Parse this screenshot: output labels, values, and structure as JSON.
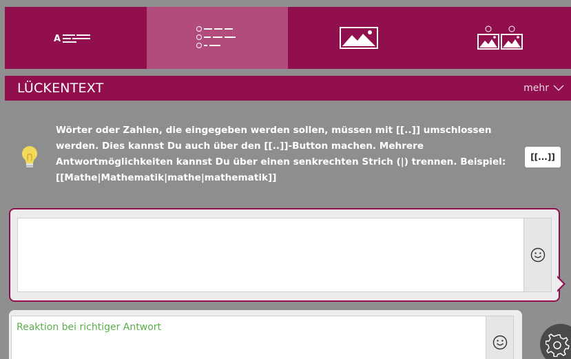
{
  "tabs": [
    {
      "icon": "text-icon",
      "label": "Text"
    },
    {
      "icon": "list-choice-icon",
      "label": "Liste"
    },
    {
      "icon": "image-icon",
      "label": "Bild"
    },
    {
      "icon": "image-compare-icon",
      "label": "Bildvergleich"
    }
  ],
  "header": {
    "title": "LÜCKENTEXT",
    "more_label": "mehr"
  },
  "hint": {
    "text": "Wörter oder Zahlen, die eingegeben werden sollen, müssen mit [[..]] umschlossen werden. Dies kannst Du auch über den [[..]]-Button machen. Mehrere Antwortmöglichkeiten kannst Du über einen senkrechten Strich (|) trennen. Beispiel: [[Mathe|Mathematik|mathe|mathematik]]",
    "insert_button": "[[...]]"
  },
  "editor": {
    "value": ""
  },
  "feedback": {
    "placeholder": "Reaktion bei richtiger Antwort"
  },
  "colors": {
    "brand": "#920f4d",
    "tab_active": "#b14c7c",
    "background": "#8f8f8f",
    "feedback_text": "#5aaf49"
  }
}
